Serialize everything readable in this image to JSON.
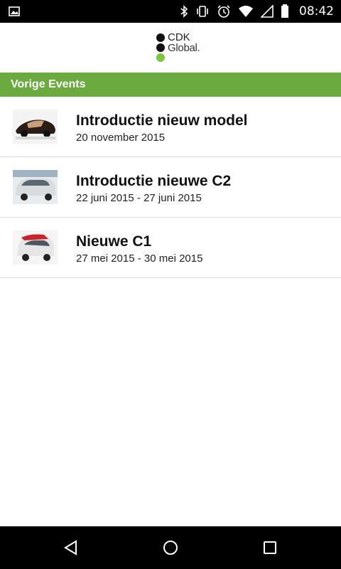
{
  "status_bar": {
    "time": "08:42"
  },
  "header": {
    "logo_line1": "CDK",
    "logo_line2": "Global."
  },
  "section": {
    "title": "Vorige Events"
  },
  "events": [
    {
      "title": "Introductie nieuw model",
      "date": "20 november 2015"
    },
    {
      "title": "Introductie nieuwe C2",
      "date": "22 juni 2015 - 27 juni 2015"
    },
    {
      "title": "Nieuwe C1",
      "date": "27 mei 2015 - 30 mei 2015"
    }
  ],
  "colors": {
    "accent": "#6aaa3e",
    "logo_green": "#7cc63d",
    "status_bar": "#000000"
  },
  "icons": {
    "status": [
      "image-icon",
      "bluetooth-icon",
      "vibrate-icon",
      "alarm-icon",
      "wifi-icon",
      "signal-icon",
      "battery-icon"
    ],
    "nav": [
      "back-icon",
      "home-icon",
      "recents-icon"
    ]
  }
}
